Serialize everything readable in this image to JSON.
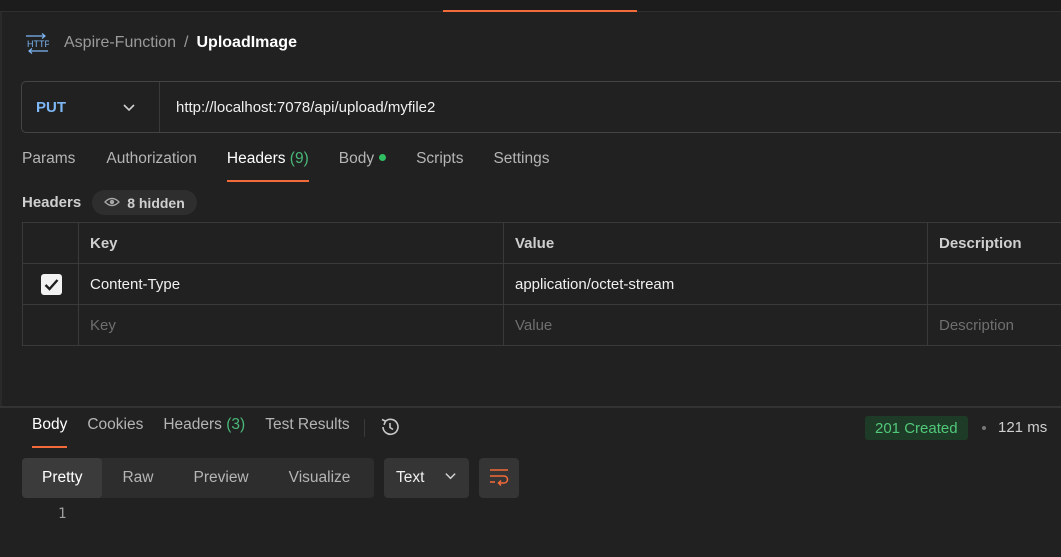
{
  "breadcrumb": {
    "icon": "http-icon",
    "parent": "Aspire-Function",
    "separator": "/",
    "current": "UploadImage"
  },
  "request": {
    "method": "PUT",
    "url": "http://localhost:7078/api/upload/myfile2"
  },
  "request_tabs": [
    {
      "label": "Params"
    },
    {
      "label": "Authorization"
    },
    {
      "label": "Headers",
      "count": "(9)"
    },
    {
      "label": "Body"
    },
    {
      "label": "Scripts"
    },
    {
      "label": "Settings"
    }
  ],
  "headers_section": {
    "title": "Headers",
    "hidden_label": "8 hidden",
    "columns": {
      "key": "Key",
      "value": "Value",
      "description": "Description"
    },
    "rows": [
      {
        "checked": true,
        "key": "Content-Type",
        "value": "application/octet-stream",
        "description": ""
      }
    ],
    "placeholders": {
      "key": "Key",
      "value": "Value",
      "description": "Description"
    }
  },
  "response_tabs": [
    {
      "label": "Body"
    },
    {
      "label": "Cookies"
    },
    {
      "label": "Headers",
      "count": "(3)"
    },
    {
      "label": "Test Results"
    }
  ],
  "response_status": {
    "status": "201 Created",
    "time": "121 ms"
  },
  "view_modes": [
    "Pretty",
    "Raw",
    "Preview",
    "Visualize"
  ],
  "format_select": "Text",
  "line_number": "1",
  "colors": {
    "accent": "#f26b3a",
    "method": "#7db7f5",
    "success": "#52c97a"
  }
}
